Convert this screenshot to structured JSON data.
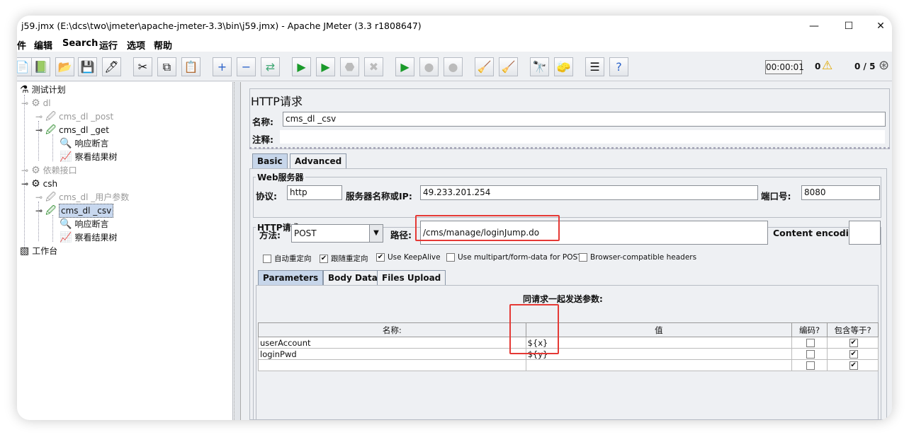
{
  "window": {
    "title": "j59.jmx (E:\\dcs\\two\\jmeter\\apache-jmeter-3.3\\bin\\j59.jmx) - Apache JMeter (3.3 r1808647)",
    "minimize": "—",
    "maximize": "☐",
    "close": "✕"
  },
  "menu": [
    "件",
    "编辑",
    "Search",
    "运行",
    "选项",
    "帮助"
  ],
  "toolbar": {
    "timer": "00:00:01",
    "warnings": "0",
    "threads": "0 / 5",
    "icons": [
      "new-icon",
      "templates-icon",
      "open-icon",
      "save-icon",
      "save-as-icon",
      "cut-icon",
      "copy-icon",
      "paste-icon",
      "expand-icon",
      "collapse-icon",
      "toggle-icon",
      "start-icon",
      "start-no-pause-icon",
      "stop-icon",
      "shutdown-icon",
      "remote-start-icon",
      "remote-stop-icon",
      "remote-exit-icon",
      "clear-icon",
      "clear-all-icon",
      "search-icon",
      "reset-search-icon",
      "function-helper-icon",
      "help-icon"
    ]
  },
  "tree": {
    "items": [
      {
        "label": "测试计划",
        "icon": "test-plan-icon"
      },
      {
        "label": "dl",
        "icon": "thread-group-icon",
        "disabled": true
      },
      {
        "label": "cms_dl _post",
        "icon": "sampler-icon",
        "disabled": true
      },
      {
        "label": "cms_dl _get",
        "icon": "sampler-icon"
      },
      {
        "label": "响应断言",
        "icon": "assertion-icon"
      },
      {
        "label": "察看结果树",
        "icon": "listener-icon"
      },
      {
        "label": "依赖接口",
        "icon": "thread-group-icon",
        "disabled": true
      },
      {
        "label": "csh",
        "icon": "thread-group-icon"
      },
      {
        "label": "cms_dl _用户参数",
        "icon": "sampler-icon",
        "disabled": true
      },
      {
        "label": "cms_dl _csv",
        "icon": "sampler-icon",
        "selected": true
      },
      {
        "label": "响应断言",
        "icon": "assertion-icon"
      },
      {
        "label": "察看结果树",
        "icon": "listener-icon"
      },
      {
        "label": "工作台",
        "icon": "workbench-icon"
      }
    ]
  },
  "panel": {
    "title": "HTTP请求",
    "name_label": "名称:",
    "name_value": "cms_dl _csv",
    "comment_label": "注释:",
    "tabs": [
      "Basic",
      "Advanced"
    ],
    "web_server_legend": "Web服务器",
    "protocol_label": "协议:",
    "protocol_value": "http",
    "server_label": "服务器名称或IP:",
    "server_value": "49.233.201.254",
    "port_label": "端口号:",
    "port_value": "8080",
    "http_request_legend": "HTTP请求",
    "method_label": "方法:",
    "method_value": "POST",
    "path_label": "路径:",
    "path_value": "/cms/manage/loginJump.do",
    "encoding_label": "Content encoding:",
    "checkboxes": [
      {
        "label": "自动重定向",
        "checked": false
      },
      {
        "label": "跟随重定向",
        "checked": true
      },
      {
        "label": "Use KeepAlive",
        "checked": true
      },
      {
        "label": "Use multipart/form-data for POST",
        "checked": false
      },
      {
        "label": "Browser-compatible headers",
        "checked": false
      }
    ],
    "subtabs": [
      "Parameters",
      "Body Data",
      "Files Upload"
    ],
    "params_caption": "同请求一起发送参数:",
    "columns": [
      "名称:",
      "值",
      "编码?",
      "包含等于?"
    ],
    "rows": [
      {
        "name": "userAccount",
        "value": "${x}",
        "encode": false,
        "include_equals": true
      },
      {
        "name": "loginPwd",
        "value": "${y}",
        "encode": false,
        "include_equals": true
      },
      {
        "name": "",
        "value": "",
        "encode": false,
        "include_equals": true
      }
    ]
  },
  "colors": {
    "highlight_box": "#e53935",
    "selection": "#c8d8ef",
    "active_tab": "#c7d6ea"
  }
}
